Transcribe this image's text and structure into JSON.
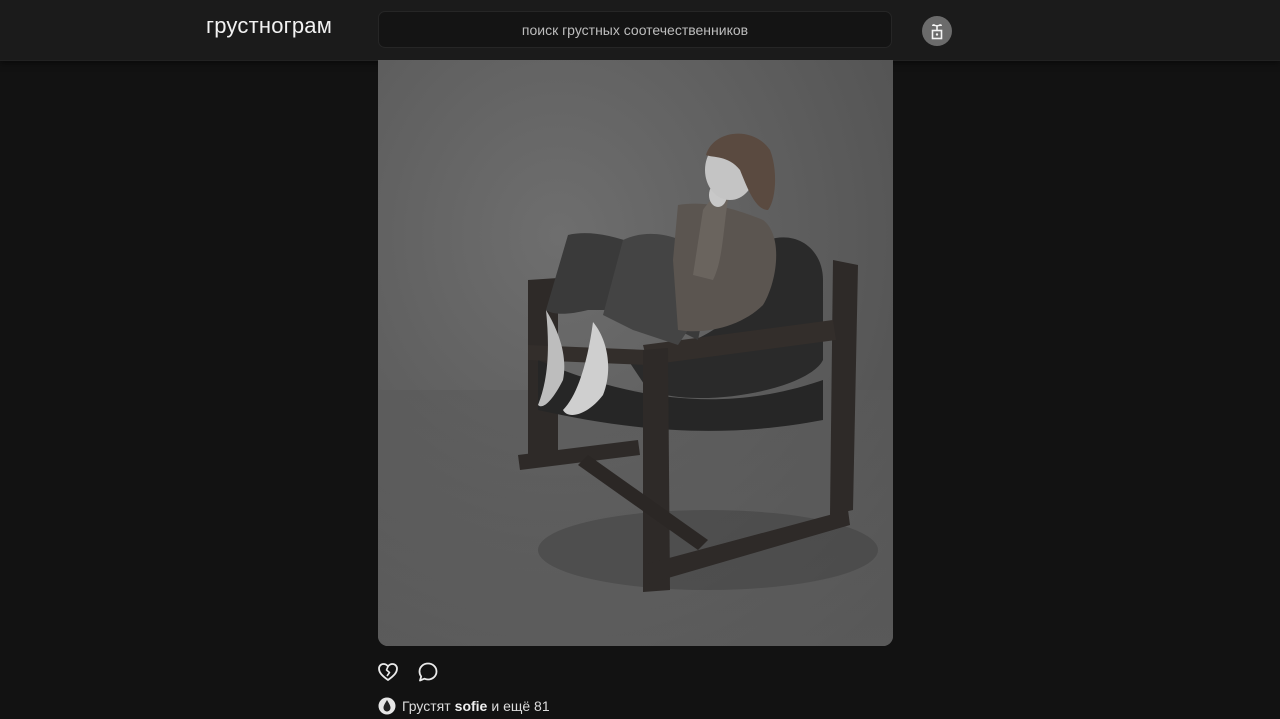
{
  "app": {
    "logo": "грустнограм"
  },
  "search": {
    "placeholder": "поиск грустных соотечественников"
  },
  "header": {
    "profile_icon": "plant-pot-icon"
  },
  "post": {
    "image_description_icon": "photo",
    "actions": {
      "like_icon": "broken-heart-icon",
      "comment_icon": "comment-bubble-icon"
    },
    "likes": {
      "prefix": "Грустят",
      "user": "sofie",
      "suffix": "и ещё 81",
      "icon": "teardrop-icon"
    }
  },
  "colors": {
    "background": "#121212",
    "topbar": "#1b1b1b",
    "avatar": "#6b6b6b"
  }
}
